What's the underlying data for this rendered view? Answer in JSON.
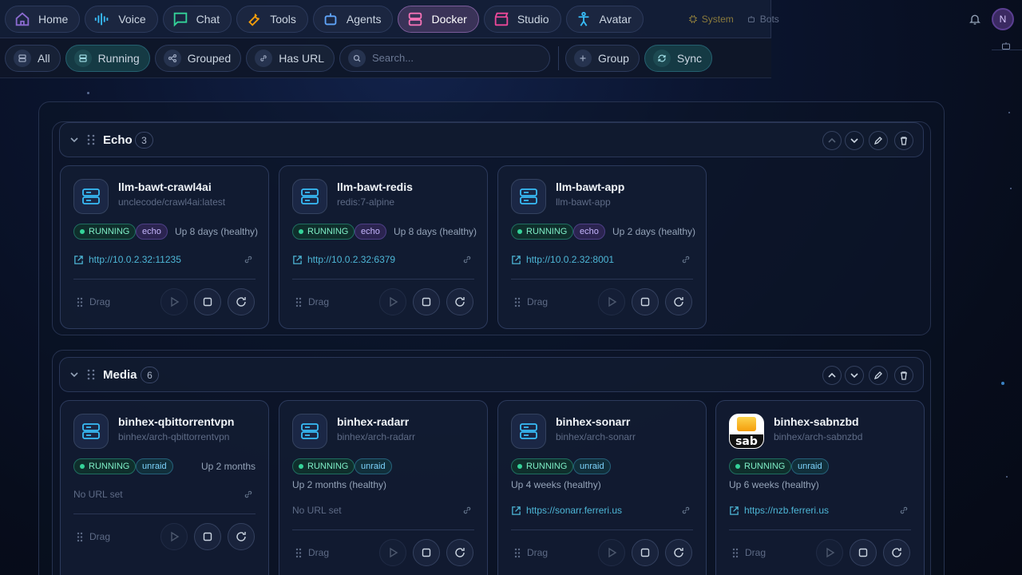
{
  "nav": {
    "items": [
      {
        "label": "Home",
        "icon": "home-icon"
      },
      {
        "label": "Voice",
        "icon": "waveform-icon"
      },
      {
        "label": "Chat",
        "icon": "chat-bubble-icon"
      },
      {
        "label": "Tools",
        "icon": "wrench-icon"
      },
      {
        "label": "Agents",
        "icon": "robot-icon"
      },
      {
        "label": "Docker",
        "icon": "server-icon",
        "active": true
      },
      {
        "label": "Studio",
        "icon": "clapperboard-icon"
      },
      {
        "label": "Avatar",
        "icon": "person-icon"
      }
    ],
    "system_label": "System",
    "bots_label": "Bots",
    "avatar_initial": "N"
  },
  "filters": {
    "all_label": "All",
    "running_label": "Running",
    "grouped_label": "Grouped",
    "has_url_label": "Has URL",
    "search_placeholder": "Search...",
    "group_label": "Group",
    "sync_label": "Sync"
  },
  "groups": [
    {
      "name": "Echo",
      "count": "3",
      "containers": [
        {
          "name": "llm-bawt-crawl4ai",
          "image": "unclecode/crawl4ai:latest",
          "state": "RUNNING",
          "tag": "echo",
          "status": "Up 8 days (healthy)",
          "url": "http://10.0.2.32:11235",
          "drag": "Drag"
        },
        {
          "name": "llm-bawt-redis",
          "image": "redis:7-alpine",
          "state": "RUNNING",
          "tag": "echo",
          "status": "Up 8 days (healthy)",
          "url": "http://10.0.2.32:6379",
          "drag": "Drag"
        },
        {
          "name": "llm-bawt-app",
          "image": "llm-bawt-app",
          "state": "RUNNING",
          "tag": "echo",
          "status": "Up 2 days (healthy)",
          "url": "http://10.0.2.32:8001",
          "drag": "Drag"
        }
      ]
    },
    {
      "name": "Media",
      "count": "6",
      "containers": [
        {
          "name": "binhex-qbittorrentvpn",
          "image": "binhex/arch-qbittorrentvpn",
          "state": "RUNNING",
          "tag": "unraid",
          "status": "Up 2 months",
          "url": "No URL set",
          "drag": "Drag"
        },
        {
          "name": "binhex-radarr",
          "image": "binhex/arch-radarr",
          "state": "RUNNING",
          "tag": "unraid",
          "status": "Up 2 months (healthy)",
          "url": "No URL set",
          "drag": "Drag"
        },
        {
          "name": "binhex-sonarr",
          "image": "binhex/arch-sonarr",
          "state": "RUNNING",
          "tag": "unraid",
          "status": "Up 4 weeks (healthy)",
          "url": "https://sonarr.ferreri.us",
          "drag": "Drag"
        },
        {
          "name": "binhex-sabnzbd",
          "image": "binhex/arch-sabnzbd",
          "state": "RUNNING",
          "tag": "unraid",
          "status": "Up 6 weeks (healthy)",
          "url": "https://nzb.ferreri.us",
          "drag": "Drag",
          "logo_text": "sab"
        }
      ]
    }
  ],
  "colors": {
    "accent_running": "#34d399",
    "accent_url": "#4db6d6",
    "accent_active_nav": "#7b5c9a"
  }
}
